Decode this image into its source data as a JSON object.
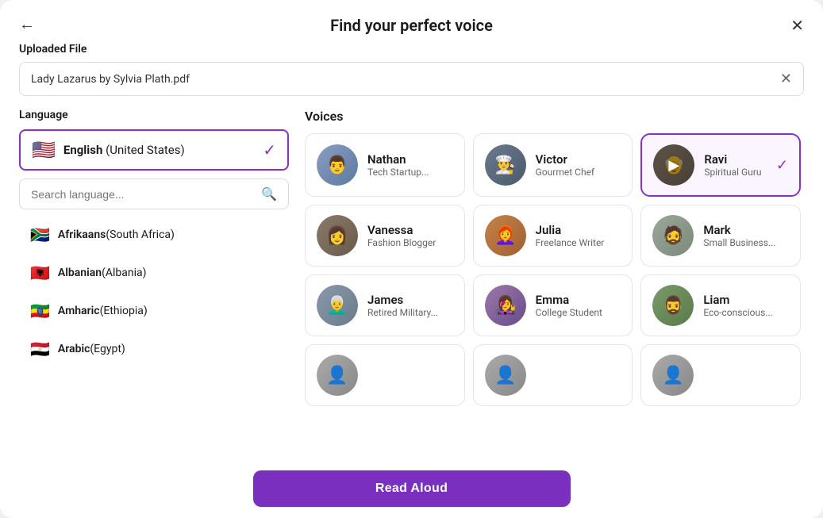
{
  "modal": {
    "title": "Find your perfect voice",
    "back_label": "←",
    "close_label": "✕"
  },
  "uploaded": {
    "label": "Uploaded File",
    "file_name": "Lady Lazarus by Sylvia Plath.pdf",
    "clear_label": "✕"
  },
  "language": {
    "label": "Language",
    "selected": {
      "flag": "🇺🇸",
      "name": "English",
      "region": " (United States)"
    },
    "search_placeholder": "Search language...",
    "list": [
      {
        "flag": "🇿🇦",
        "name": "Afrikaans",
        "region": " (South Africa)"
      },
      {
        "flag": "🇦🇱",
        "name": "Albanian",
        "region": " (Albania)"
      },
      {
        "flag": "🇪🇹",
        "name": "Amharic",
        "region": " (Ethiopia)"
      },
      {
        "flag": "🇪🇬",
        "name": "Arabic",
        "region": " (Egypt)"
      }
    ]
  },
  "voices": {
    "label": "Voices",
    "items": [
      {
        "id": "nathan",
        "name": "Nathan",
        "role": "Tech Startup...",
        "avatar_class": "av-nathan",
        "emoji": "👨",
        "selected": false
      },
      {
        "id": "victor",
        "name": "Victor",
        "role": "Gourmet Chef",
        "avatar_class": "av-victor",
        "emoji": "👨‍🍳",
        "selected": false
      },
      {
        "id": "ravi",
        "name": "Ravi",
        "role": "Spiritual Guru",
        "avatar_class": "av-ravi",
        "emoji": "👴",
        "selected": true
      },
      {
        "id": "vanessa",
        "name": "Vanessa",
        "role": "Fashion Blogger",
        "avatar_class": "av-vanessa",
        "emoji": "👩",
        "selected": false
      },
      {
        "id": "julia",
        "name": "Julia",
        "role": "Freelance Writer",
        "avatar_class": "av-julia",
        "emoji": "👩‍🦰",
        "selected": false
      },
      {
        "id": "mark",
        "name": "Mark",
        "role": "Small Business...",
        "avatar_class": "av-mark",
        "emoji": "🧔",
        "selected": false
      },
      {
        "id": "james",
        "name": "James",
        "role": "Retired Military...",
        "avatar_class": "av-james",
        "emoji": "👨‍🦳",
        "selected": false
      },
      {
        "id": "emma",
        "name": "Emma",
        "role": "College Student",
        "avatar_class": "av-emma",
        "emoji": "👩‍🎤",
        "selected": false
      },
      {
        "id": "liam",
        "name": "Liam",
        "role": "Eco-conscious...",
        "avatar_class": "av-liam",
        "emoji": "🧔‍♂️",
        "selected": false
      },
      {
        "id": "partial1",
        "name": "",
        "role": "",
        "avatar_class": "av-partial",
        "emoji": "👤",
        "selected": false
      },
      {
        "id": "partial2",
        "name": "",
        "role": "",
        "avatar_class": "av-partial",
        "emoji": "👤",
        "selected": false
      },
      {
        "id": "partial3",
        "name": "",
        "role": "",
        "avatar_class": "av-partial",
        "emoji": "👤",
        "selected": false
      }
    ]
  },
  "bottom": {
    "read_aloud_label": "Read Aloud"
  }
}
